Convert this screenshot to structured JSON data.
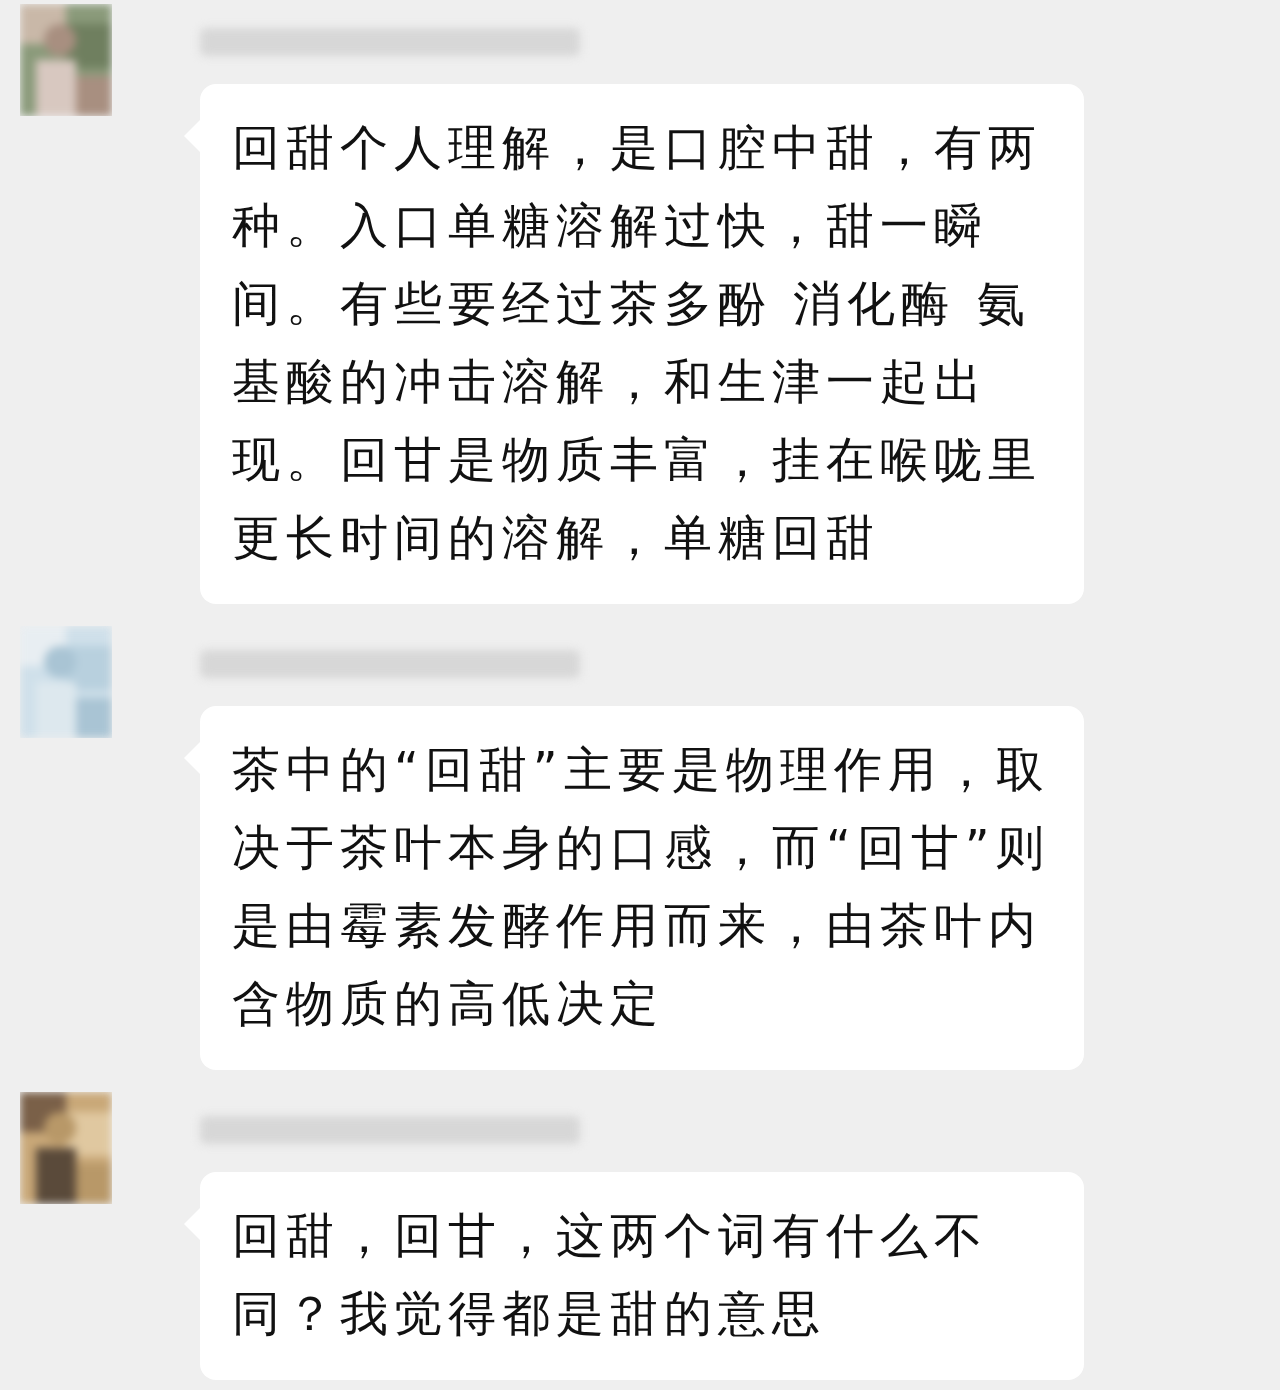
{
  "messages": [
    {
      "text": "回甜个人理解，是口腔中甜，有两种。入口单糖溶解过快，甜一瞬间。有些要经过茶多酚 消化酶 氨基酸的冲击溶解，和生津一起出现。回甘是物质丰富，挂在喉咙里更长时间的溶解，单糖回甜"
    },
    {
      "text": "茶中的“回甜”主要是物理作用，取决于茶叶本身的口感，而“回甘”则是由霉素发酵作用而来，由茶叶内含物质的高低决定"
    },
    {
      "text": "回甜，回甘，这两个词有什么不同？我觉得都是甜的意思"
    }
  ]
}
